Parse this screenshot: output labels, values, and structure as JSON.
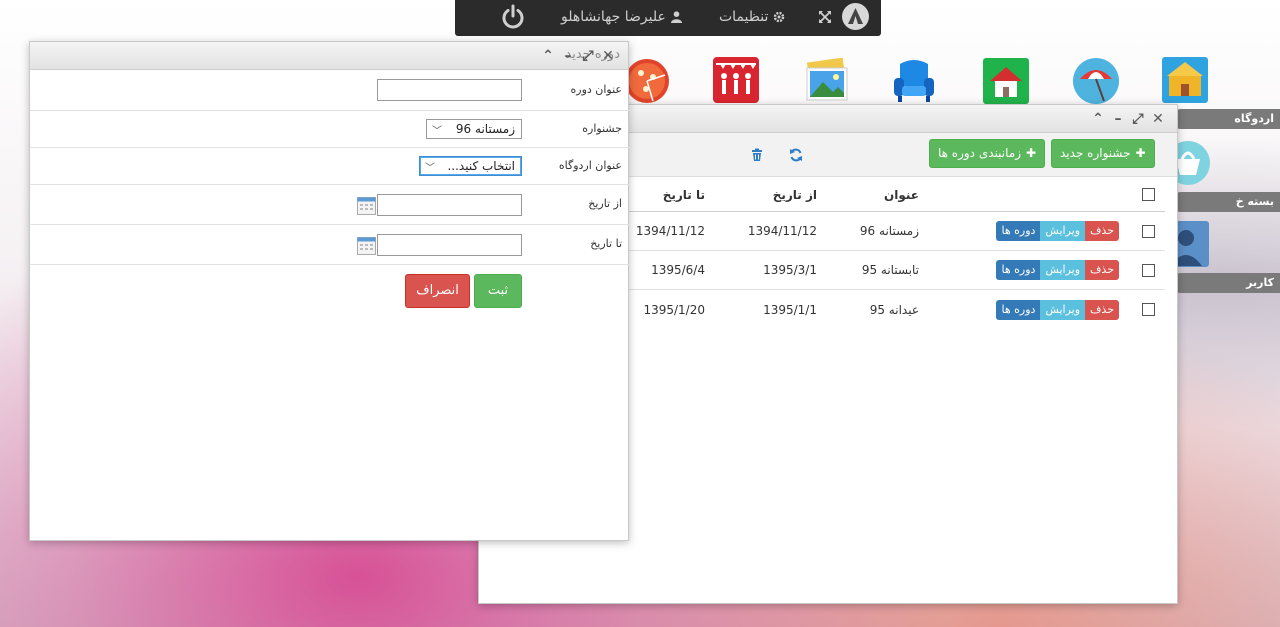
{
  "topbar": {
    "user_name": "علیرضا جهانشاهلو",
    "settings_label": "تنظیمات"
  },
  "desktop_labels": {
    "camps": "اردوگاه",
    "packages": "بسته خ",
    "users": "کاربر"
  },
  "back_window": {
    "toolbar": {
      "new_festival": "جشنواره جدید",
      "schedule_courses": "زمانبندی دوره ها"
    },
    "columns": {
      "title": "عنوان",
      "from_date": "از تاریخ",
      "to_date": "تا تاریخ"
    },
    "actions": {
      "delete": "حذف",
      "edit": "ویرایش",
      "courses": "دوره ها"
    },
    "rows": [
      {
        "title": "زمستانه 96",
        "from": "1394/11/12",
        "to": "1394/11/12"
      },
      {
        "title": "تابستانه 95",
        "from": "1395/3/1",
        "to": "1395/6/4"
      },
      {
        "title": "عیدانه 95",
        "from": "1395/1/1",
        "to": "1395/1/20"
      }
    ]
  },
  "dialog": {
    "title": "دوره جدید",
    "course_title_label": "عنوان دوره",
    "festival_label": "جشنواره",
    "festival_value": "زمستانه 96",
    "camp_title_label": "عنوان اردوگاه",
    "camp_value": "انتخاب کنید...",
    "from_date_label": "از تاریخ",
    "to_date_label": "تا تاریخ",
    "save_label": "ثبت",
    "cancel_label": "انصراف"
  },
  "colors": {
    "green": "#5cb85c",
    "red": "#d9534f",
    "blue": "#337ab7",
    "light_blue": "#5bc0de",
    "topbar": "#2b2b2b"
  }
}
